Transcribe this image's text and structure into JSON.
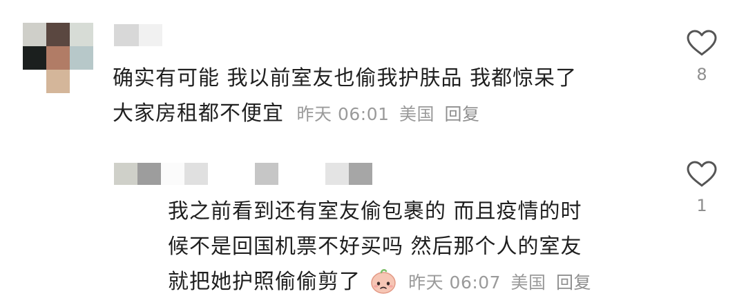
{
  "comments": [
    {
      "text_line1": "确实有可能 我以前室友也偷我护肤品 我都惊呆了",
      "text_line2": "大家房租都不便宜",
      "time": "昨天 06:01",
      "location": "美国",
      "reply_label": "回复",
      "like_count": "8"
    },
    {
      "text_line1": "我之前看到还有室友偷包裹的 而且疫情的时",
      "text_line2": "候不是回国机票不好买吗 然后那个人的室友",
      "text_line3": "就把她护照偷偷剪了",
      "time": "昨天 06:07",
      "location": "美国",
      "reply_label": "回复",
      "like_count": "1"
    }
  ],
  "icons": {
    "like": "heart-outline-icon",
    "emoji": "sad-face-emoji-icon"
  },
  "colors": {
    "text": "#1f1f1f",
    "meta": "#9a9a9a",
    "icon": "#555555"
  }
}
